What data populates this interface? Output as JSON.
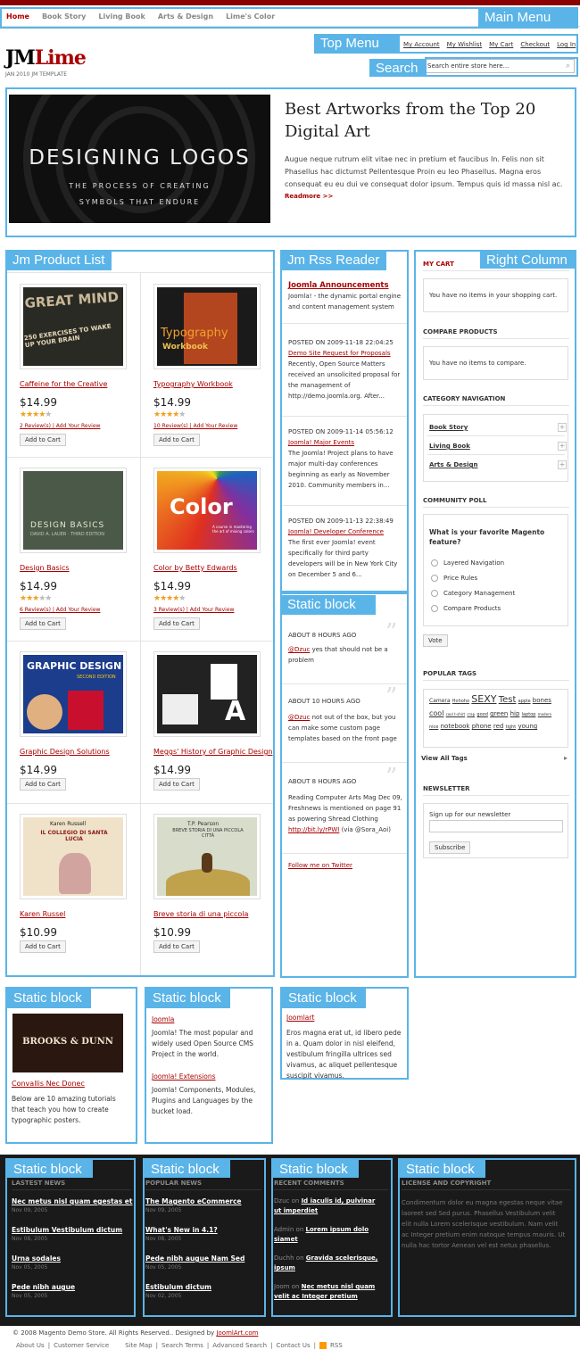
{
  "main_menu": {
    "items": [
      "Home",
      "Book Story",
      "Living Book",
      "Arts & Design",
      "Lime's Color"
    ],
    "label": "Main Menu"
  },
  "top_menu": {
    "label": "Top Menu",
    "links": [
      "My Account",
      "My Wishlist",
      "My Cart",
      "Checkout",
      "Log In"
    ]
  },
  "search": {
    "label": "Search",
    "placeholder": "Search entire store here..."
  },
  "logo": {
    "part1": "JM",
    "part2": "Lime",
    "tagline": "JAN 2010 JM TEMPLATE"
  },
  "banner": {
    "image_title": "DESIGNING LOGOS",
    "image_subtitle_1": "THE PROCESS OF CREATING",
    "image_subtitle_2": "SYMBOLS THAT ENDURE",
    "title": "Best Artworks from the Top 20 Digital Art",
    "text": "Augue neque rutrum elit vitae nec in pretium et faucibus In. Felis non sit Phasellus hac dictumst Pellentesque Proin eu leo Phasellus. Magna eros consequat eu eu dui ve consequat dolor ipsum. Tempus quis id massa nisl ac.",
    "more": "Readmore >>"
  },
  "product_list": {
    "label": "Jm Product List",
    "add_to_cart": "Add to Cart",
    "products": [
      {
        "name": "Caffeine for the Creative",
        "price": "$14.99",
        "rating": 4,
        "reviews": "2 Review(s)",
        "add_review": "Add Your Review",
        "cover": "GREAT MIND",
        "cover2": "250 EXERCISES TO WAKE UP YOUR BRAIN"
      },
      {
        "name": "Typography Workbook",
        "price": "$14.99",
        "rating": 4,
        "reviews": "10 Review(s)",
        "add_review": "Add Your Review",
        "cover": "Typography",
        "cover2": "Workbook"
      },
      {
        "name": "Design Basics",
        "price": "$14.99",
        "rating": 3,
        "reviews": "6 Review(s)",
        "add_review": "Add Your Review",
        "cover": "DESIGN BASICS",
        "cover2": "DAVID A. LAUER · THIRD EDITION"
      },
      {
        "name": "Color by Betty Edwards",
        "price": "$14.99",
        "rating": 4,
        "reviews": "3 Review(s)",
        "add_review": "Add Your Review",
        "cover": "Color",
        "cover2": "A course in mastering the art of mixing colors"
      },
      {
        "name": "Graphic Design Solutions",
        "price": "$14.99",
        "cover": "GRAPHIC DESIGN",
        "cover2": "SECOND EDITION"
      },
      {
        "name": "Meggs' History of Graphic Design",
        "price": "$14.99",
        "cover": "A",
        "cover2": ""
      },
      {
        "name": "Karen Russel",
        "price": "$10.99",
        "cover": "Karen Russell",
        "cover2": "IL COLLEGIO DI SANTA LUCIA"
      },
      {
        "name": "Breve storia di una piccola",
        "price": "$10.99",
        "cover": "T.P. Pearson",
        "cover2": "BREVE STORIA DI UNA PICCOLA CITTÀ"
      }
    ]
  },
  "rss": {
    "label": "Jm Rss Reader",
    "heading": "Joomla Announcements",
    "intro": "Joomla! - the dynamic portal engine and content management system",
    "items": [
      {
        "posted": "POSTED ON 2009-11-18 22:04:25",
        "title": "Demo Site Request for Proposals",
        "text": "Recently, Open Source Matters received an unsolicited proposal for the management of http://demo.joomla.org. After..."
      },
      {
        "posted": "POSTED ON 2009-11-14 05:56:12",
        "title": "Joomla! Major Events",
        "text": "The Joomla! Project plans to have major multi-day conferences beginning as early as November 2010. Community members in..."
      },
      {
        "posted": "POSTED ON 2009-11-13 22:38:49",
        "title": "Joomla! Developer Conference",
        "text": "The first ever Joomla! event specifically for third party developers will be in New York City on December 5 and 6..."
      }
    ]
  },
  "twitter": {
    "label": "Static block",
    "tweets": [
      {
        "time": "ABOUT 8 HOURS AGO",
        "user": "@Dzuc",
        "text": "yes that should not be a problem"
      },
      {
        "time": "ABOUT 10 HOURS AGO",
        "user": "@Dzuc",
        "text": "not out of the box, but you can make some custom page templates based on the front page"
      },
      {
        "time": "ABOUT 8 HOURS AGO",
        "text": "Reading Computer Arts Mag Dec 09, Freshnews is mentioned on page 91 as powering Shread Clothing",
        "link": "http://bit.ly/rPWI",
        "via": "(via @Sora_Aoi)"
      }
    ],
    "follow": "Follow me on Twitter"
  },
  "right_column": {
    "label": "Right Column",
    "cart_title": "MY CART",
    "cart_text": "You have no items in your shopping cart.",
    "compare_title": "COMPARE PRODUCTS",
    "compare_text": "You have no items to compare.",
    "cat_title": "CATEGORY NAVIGATION",
    "categories": [
      "Book Story",
      "Living Book",
      "Arts & Design"
    ],
    "poll_title": "COMMUNITY POLL",
    "poll_question": "What is your favorite Magento feature?",
    "poll_options": [
      "Layered Navigation",
      "Price Rules",
      "Category Management",
      "Compare Products"
    ],
    "vote": "Vote",
    "tags_title": "POPULAR TAGS",
    "tags": [
      "Camera",
      "Hohoho",
      "SEXY",
      "Test",
      "apple",
      "bones",
      "cool",
      "cool t-shirt",
      "crap",
      "good",
      "green",
      "hip",
      "laptop",
      "modern",
      "nice",
      "notebook",
      "phone",
      "red",
      "tight",
      "young"
    ],
    "view_all": "View All Tags",
    "news_title": "NEWSLETTER",
    "news_text": "Sign up for our newsletter",
    "subscribe": "Subscribe"
  },
  "static_blocks": {
    "label": "Static block",
    "block1": {
      "image_text": "BROOKS & DUNN",
      "link": "Convallis Nec Donec",
      "text": "Below are 10 amazing tutorials that teach you how to create typographic posters."
    },
    "block2": {
      "link1": "Joomla",
      "text1": "Joomla! The most popular and widely used Open Source CMS Project in the world.",
      "link2": "Joomla! Extensions",
      "text2": "Joomla! Components, Modules, Plugins and Languages by the bucket load."
    },
    "block3": {
      "link": "Joomlart",
      "text": "Eros magna erat ut, id libero pede in a. Quam dolor in nisl eleifend, vestibulum fringilla ultrices sed vivamus, ac aliquet pellentesque suscipit vivamus."
    }
  },
  "footer": {
    "label": "Static block",
    "latest": {
      "title": "LASTEST NEWS",
      "items": [
        {
          "t": "Nec metus nisl quam egestas et",
          "d": "Nov 09, 2005"
        },
        {
          "t": "Estibulum Vestibulum dictum",
          "d": "Nov 08, 2005"
        },
        {
          "t": "Urna sodales",
          "d": "Nov 05, 2005"
        },
        {
          "t": "Pede nibh augue",
          "d": "Nov 05, 2005"
        }
      ]
    },
    "popular": {
      "title": "POPULAR NEWS",
      "items": [
        {
          "t": "The Magento eCommerce",
          "d": "Nov 09, 2005"
        },
        {
          "t": "What's New in 4.1?",
          "d": "Nov 08, 2005"
        },
        {
          "t": "Pede nibh augue Nam Sed",
          "d": "Nov 05, 2005"
        },
        {
          "t": "Estibulum dictum",
          "d": "Nov 02, 2005"
        }
      ]
    },
    "comments": {
      "title": "RECENT COMMENTS",
      "items": [
        {
          "u": "Dzuc",
          "on": "on",
          "t": "Id iaculis id, pulvinar ut imperdiet"
        },
        {
          "u": "Admin",
          "on": "on",
          "t": "Lorem ipsum dolo siamet"
        },
        {
          "u": "Duchh",
          "on": "on",
          "t": "Gravida scelerisque, ipsum"
        },
        {
          "u": "Joom",
          "on": "on",
          "t": "Nec metus nisl quam velit ac Integer pretium"
        }
      ]
    },
    "license": {
      "title": "LICENSE AND COPYRIGHT",
      "text": "Condimentum dolor eu magna egestas neque vitae laoreet sed Sed purus. Phasellus Vestibulum velit elit nulla Lorem scelerisque vestibulum. Nam velit ac Integer pretium enim natoque tempus mauris. Ut nulla hac tortor Aenean vel est netus phasellus."
    }
  },
  "bottom": {
    "copyright": "© 2008 Magento Demo Store. All Rights Reserved.. Designed by",
    "designer": "JoomlArt.com",
    "links": [
      "About Us",
      "|",
      "Customer Service",
      "Site Map",
      "|",
      "Search Terms",
      "|",
      "Advanced Search",
      "|",
      "Contact Us",
      "|",
      "RSS"
    ]
  }
}
